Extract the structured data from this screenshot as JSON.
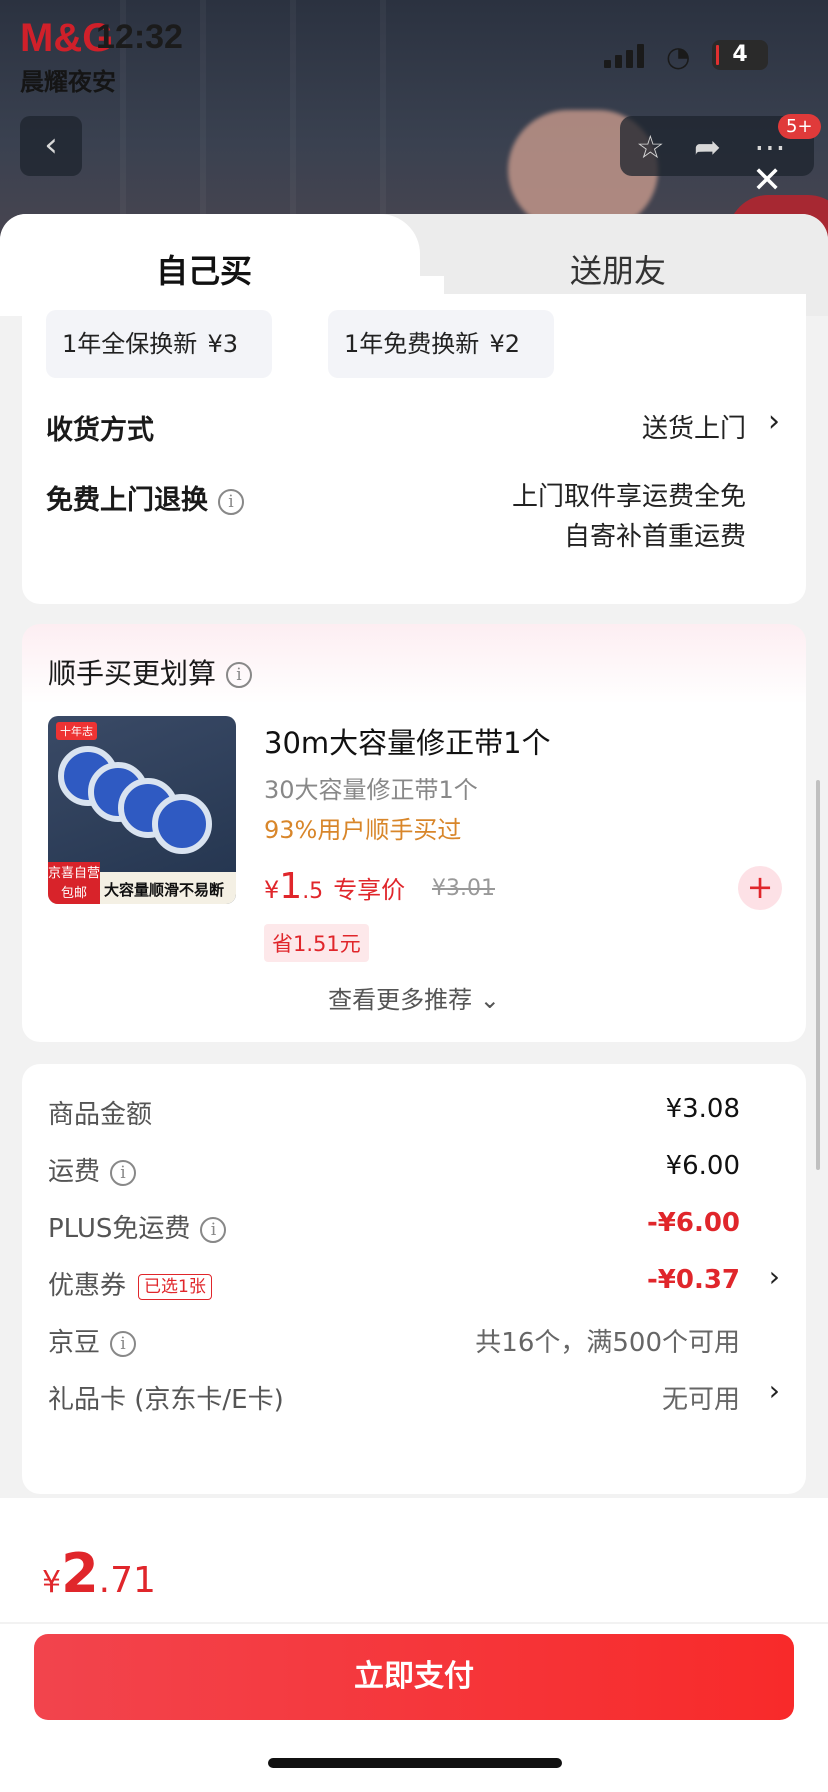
{
  "status_bar": {
    "time": "12:32",
    "battery": "4",
    "brand": "M&G",
    "brand_sub": "晨耀夜安"
  },
  "nav": {
    "back_icon": "chevron-left-icon",
    "badge": "5+"
  },
  "tabs": [
    {
      "label": "自己买",
      "active": true
    },
    {
      "label": "送朋友",
      "active": false
    }
  ],
  "service": {
    "chips": [
      {
        "label": "1年全保换新",
        "price": "¥3"
      },
      {
        "label": "1年免费换新",
        "price": "¥2"
      }
    ],
    "delivery": {
      "label": "收货方式",
      "value": "送货上门"
    },
    "free_return": {
      "label": "免费上门退换",
      "line1": "上门取件享运费全免",
      "line2": "自寄补首重运费"
    }
  },
  "recommend": {
    "title": "顺手买更划算",
    "product": {
      "title": "30m大容量修正带1个",
      "subtitle": "30大容量修正带1个",
      "bought": "93%用户顺手买过",
      "price_yen": "¥",
      "price_int": "1",
      "price_dec": ".5",
      "price_tag": "专享价",
      "original_price": "¥3.01",
      "save": "省1.51元",
      "image_logo": "十年志",
      "image_tag": "京喜自营 包邮",
      "image_text": "大容量顺滑不易断"
    },
    "more": "查看更多推荐"
  },
  "summary": {
    "items": [
      {
        "label": "商品金额",
        "value": "¥3.08"
      },
      {
        "label": "运费",
        "value": "¥6.00"
      },
      {
        "label": "PLUS免运费",
        "value": "-¥6.00"
      },
      {
        "label": "优惠券",
        "chip": "已选1张",
        "value": "-¥0.37"
      },
      {
        "label": "京豆",
        "value": "共16个，满500个可用"
      },
      {
        "label": "礼品卡 (京东卡/E卡)",
        "value": "无可用"
      }
    ]
  },
  "footer": {
    "total_yen": "¥",
    "total_int": "2",
    "total_dec": ".71",
    "pay_label": "立即支付"
  },
  "colors": {
    "accent": "#e0262b",
    "bought": "#d8862a"
  }
}
